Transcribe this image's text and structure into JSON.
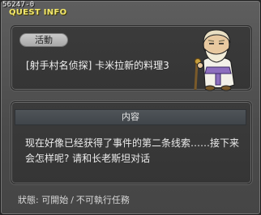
{
  "window": {
    "quest_id": "56247-0",
    "title": "QUEST INFO"
  },
  "top_panel": {
    "category_label": "活動",
    "quest_name": "[射手村名侦探] 卡米拉新的料理3"
  },
  "content_panel": {
    "header": "内容",
    "description": "现在好像已经获得了事件的第二条线索……接下来会怎样呢? 请和长老斯坦对话"
  },
  "status": {
    "label": "狀態",
    "value_1": "可開始",
    "separator": "/",
    "value_2": "不可執行任務"
  },
  "colors": {
    "title": "#f4e96a",
    "window_bg": "#4b4b4b",
    "panel_bg": "#383838",
    "pill_bg": "#b8b8b8"
  },
  "icons": {
    "npc": "elder-stan-portrait"
  }
}
